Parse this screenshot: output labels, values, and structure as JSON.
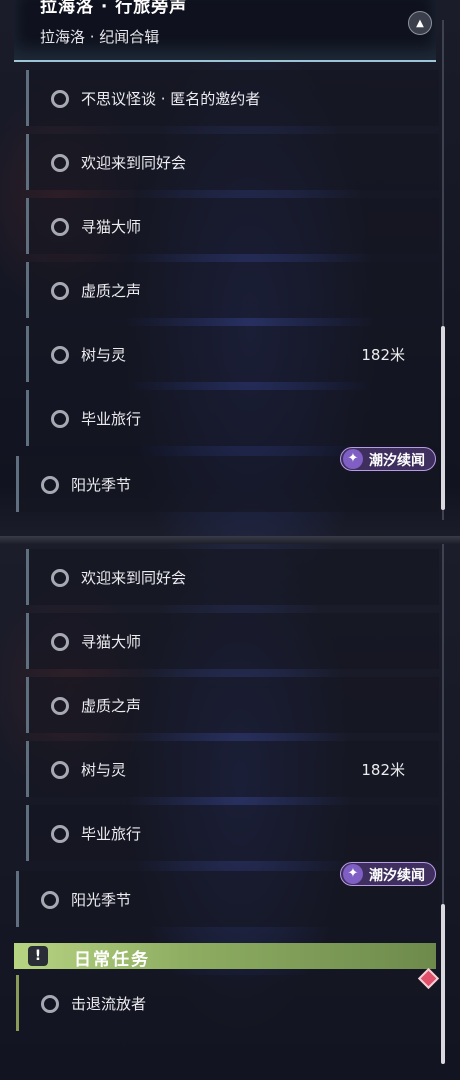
{
  "header": {
    "title": "拉海洛 · 行旅旁声",
    "subtitle": "拉海洛 · 纪闻合辑"
  },
  "top_list": [
    {
      "label": "不思议怪谈 · 匿名的邀约者",
      "distance": ""
    },
    {
      "label": "欢迎来到同好会",
      "distance": ""
    },
    {
      "label": "寻猫大师",
      "distance": ""
    },
    {
      "label": "虚质之声",
      "distance": ""
    },
    {
      "label": "树与灵",
      "distance": "182米"
    },
    {
      "label": "毕业旅行",
      "distance": ""
    },
    {
      "label": "阳光季节",
      "distance": ""
    }
  ],
  "bottom_list": [
    {
      "label": "欢迎来到同好会",
      "distance": ""
    },
    {
      "label": "寻猫大师",
      "distance": ""
    },
    {
      "label": "虚质之声",
      "distance": ""
    },
    {
      "label": "树与灵",
      "distance": "182米"
    },
    {
      "label": "毕业旅行",
      "distance": ""
    },
    {
      "label": "阳光季节",
      "distance": ""
    }
  ],
  "tag": {
    "label": "潮汐续闻",
    "icon": "spark-icon"
  },
  "daily": {
    "section_title": "日常任务",
    "icon": "exclamation-icon",
    "quest": "击退流放者"
  },
  "colors": {
    "accent_daily": "#a6c46e",
    "tag_purple": "#7f5fc4",
    "marker_red": "#e0506a"
  }
}
